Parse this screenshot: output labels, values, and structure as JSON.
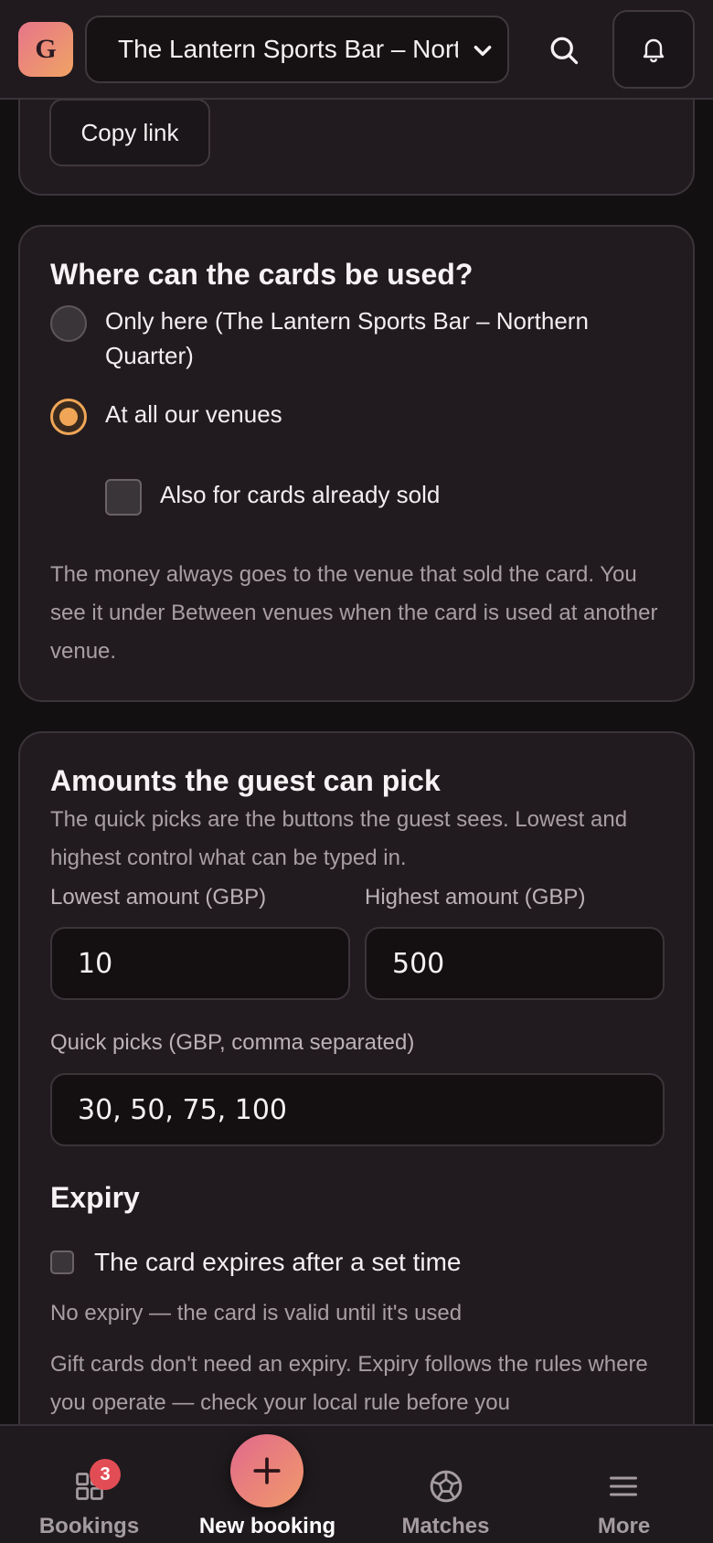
{
  "header": {
    "logo_letter": "G",
    "venue_selected": "The Lantern Sports Bar – Northern Quarter"
  },
  "share": {
    "copy_link_label": "Copy link"
  },
  "usage": {
    "title": "Where can the cards be used?",
    "option_here": "Only here (The Lantern Sports Bar – Northern Quarter)",
    "option_all": "At all our venues",
    "selected": "all",
    "also_sold_label": "Also for cards already sold",
    "also_sold_checked": false,
    "note": "The money always goes to the venue that sold the card. You see it under Between venues when the card is used at another venue."
  },
  "amounts": {
    "title": "Amounts the guest can pick",
    "description": "The quick picks are the buttons the guest sees. Lowest and highest control what can be typed in.",
    "lowest_label": "Lowest amount (GBP)",
    "lowest_value": "10",
    "highest_label": "Highest amount (GBP)",
    "highest_value": "500",
    "quick_label": "Quick picks (GBP, comma separated)",
    "quick_value": "30, 50, 75, 100"
  },
  "expiry": {
    "title": "Expiry",
    "expires_label": "The card expires after a set time",
    "expires_checked": false,
    "status": "No expiry — the card is valid until it's used",
    "note": "Gift cards don't need an expiry. Expiry follows the rules where you operate — check your local rule before you"
  },
  "nav": {
    "bookings": "Bookings",
    "bookings_badge": "3",
    "new_booking": "New booking",
    "matches": "Matches",
    "more": "More"
  },
  "colors": {
    "accent": "#f0a656",
    "badge": "#e24d55"
  }
}
